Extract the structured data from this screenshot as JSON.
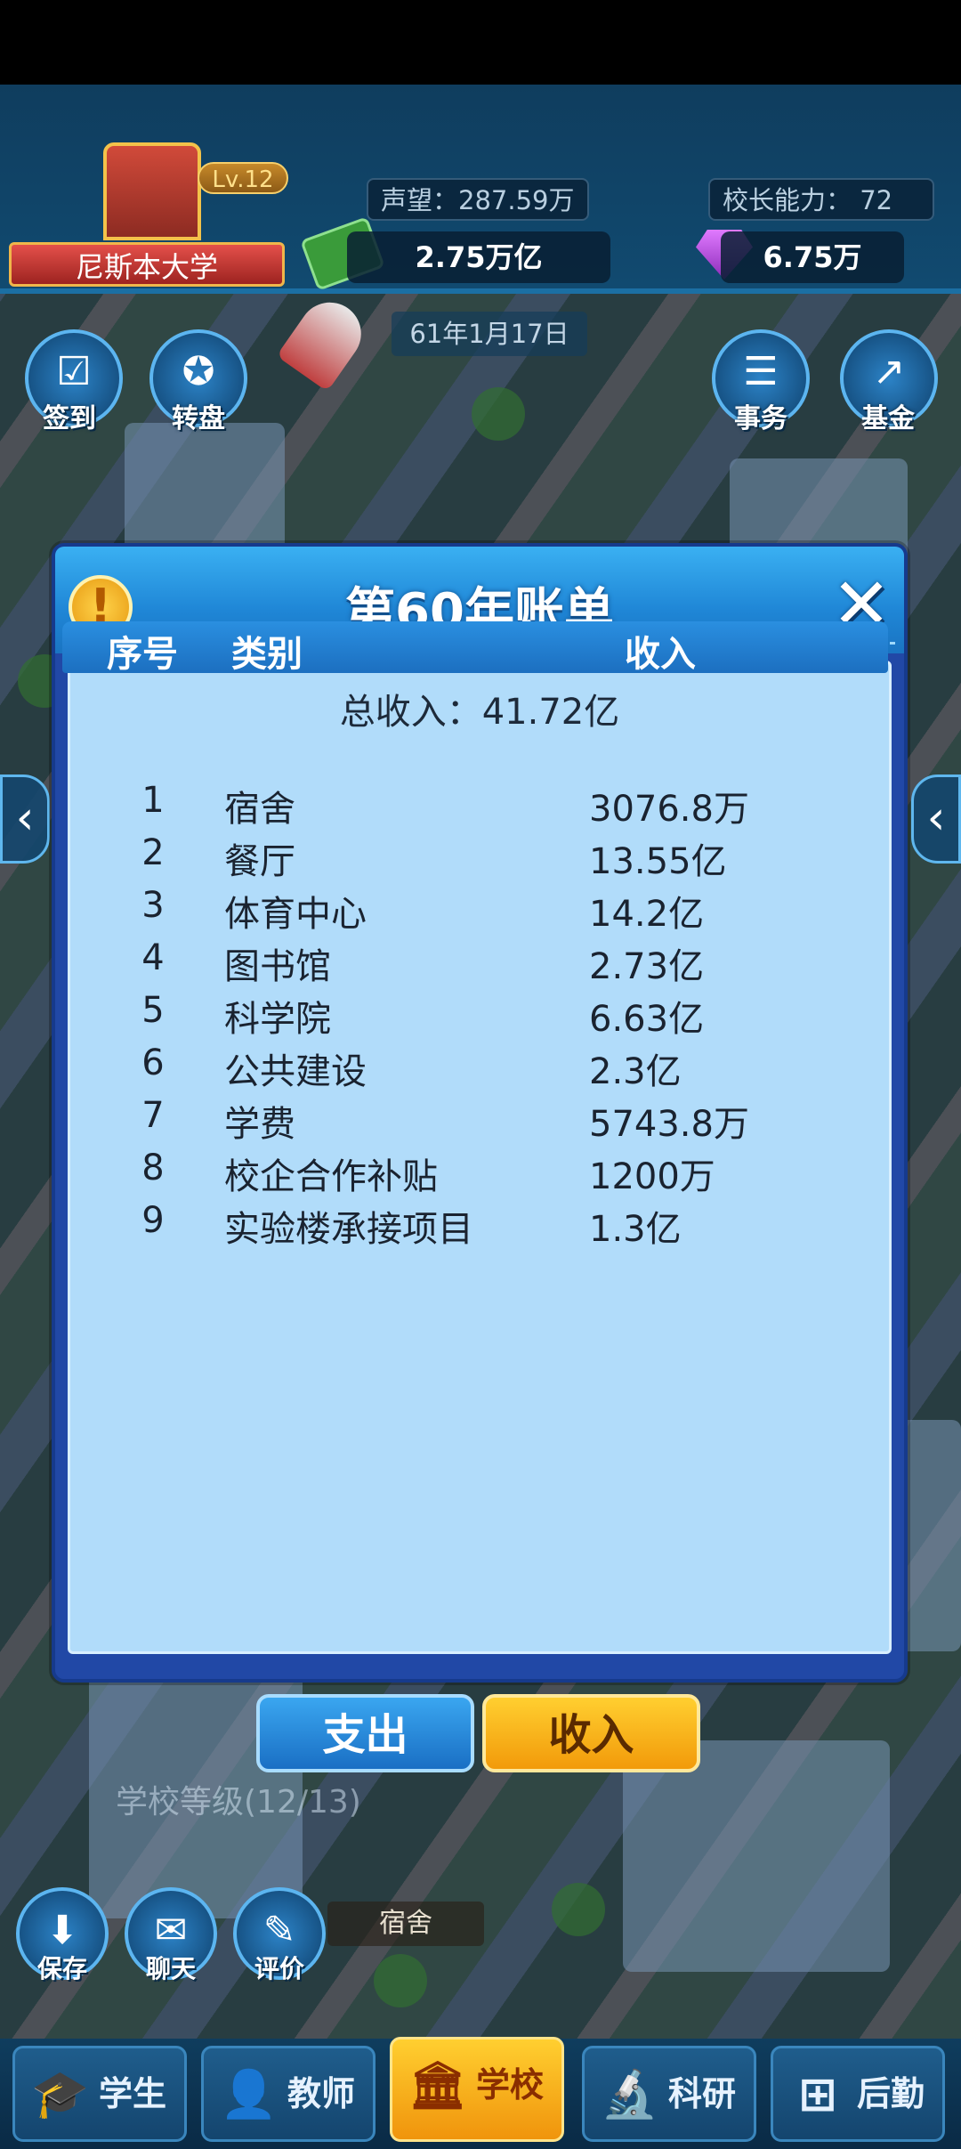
{
  "hud": {
    "school_name": "尼斯本大学",
    "level": "Lv.12",
    "reputation": "声望：287.59万",
    "principal_ability": "校长能力：  72",
    "money": "2.75万亿",
    "gems": "6.75万",
    "date": "61年1月17日"
  },
  "quick_buttons": {
    "checkin": "签到",
    "wheel": "转盘",
    "affairs": "事务",
    "fund": "基金"
  },
  "modal": {
    "title": "第60年账单",
    "total_income": "总收入：41.72亿",
    "columns": {
      "no": "序号",
      "category": "类别",
      "income": "收入"
    },
    "rows": [
      {
        "no": "1",
        "category": "宿舍",
        "income": "3076.8万"
      },
      {
        "no": "2",
        "category": "餐厅",
        "income": "13.55亿"
      },
      {
        "no": "3",
        "category": "体育中心",
        "income": "14.2亿"
      },
      {
        "no": "4",
        "category": "图书馆",
        "income": "2.73亿"
      },
      {
        "no": "5",
        "category": "科学院",
        "income": "6.63亿"
      },
      {
        "no": "6",
        "category": "公共建设",
        "income": "2.3亿"
      },
      {
        "no": "7",
        "category": "学费",
        "income": "5743.8万"
      },
      {
        "no": "8",
        "category": "校企合作补贴",
        "income": "1200万"
      },
      {
        "no": "9",
        "category": "实验楼承接项目",
        "income": "1.3亿"
      }
    ]
  },
  "tabs": {
    "spend": "支出",
    "income": "收入"
  },
  "lower": {
    "grade": "学校等级(12/13)",
    "save": "保存",
    "chat": "聊天",
    "review": "评价",
    "dorm_tag": "宿舍"
  },
  "bottom_nav": {
    "students": "学生",
    "teachers": "教师",
    "school": "学校",
    "research": "科研",
    "logistics": "后勤"
  }
}
